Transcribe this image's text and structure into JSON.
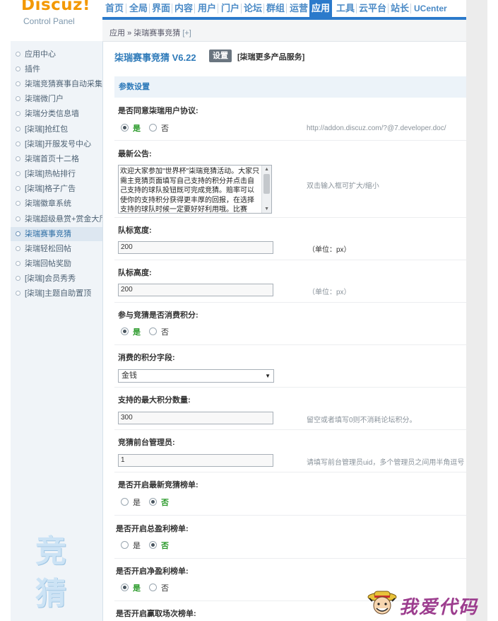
{
  "logo": {
    "main": "Discuz!",
    "sub": "Control Panel"
  },
  "nav": [
    "首页",
    "全局",
    "界面",
    "内容",
    "用户",
    "门户",
    "论坛",
    "群组",
    "运营",
    "应用",
    "工具",
    "云平台",
    "站长",
    "UCenter"
  ],
  "nav_active": "应用",
  "sidebar": {
    "items": [
      "应用中心",
      "插件",
      "柒瑞竞猜赛事自动采集插件",
      "柒瑞微门户",
      "柒瑞分类信息墙",
      "[柒瑞]抢红包",
      "[柒瑞]开服发号中心",
      "柒瑞首页十二格",
      "[柒瑞]热帖排行",
      "[柒瑞]格子广告",
      "柒瑞徽章系统",
      "柒瑞超级悬赏+赏金大厅",
      "柒瑞赛事竞猜",
      "柒瑞轻松回帖",
      "柒瑞回帖奖励",
      "[柒瑞]会员秀秀",
      "[柒瑞]主题自助置顶"
    ],
    "active": "柒瑞赛事竞猜",
    "watermark": "竞猜"
  },
  "breadcrumb": {
    "root": "应用",
    "sep": "»",
    "current": "柒瑞赛事竞猜",
    "add": "[+]"
  },
  "page": {
    "title": "柒瑞赛事竞猜 V6.22",
    "settings_button": "设置",
    "more_link": "[柒瑞更多产品服务]"
  },
  "section_title": "参数设置",
  "fields": {
    "agreement": {
      "label": "是否同意柒瑞用户协议:",
      "yes": "是",
      "no": "否",
      "comment": "http://addon.discuz.com/?@7.developer.doc/"
    },
    "notice": {
      "label": "最新公告:",
      "value": "欢迎大家参加\"世界杯\"柒瑞竞猜活动。大家只需主竞猜页面填写自己支持的积分并点击自己支持的球队投钮既可完成竞猜。赔率可以使你的支持积分获得更丰厚的回报，在选择支持的球队时候一定要好好利用哦。比赛",
      "comment": "双击输入框可扩大/缩小"
    },
    "logo_width": {
      "label": "队标宽度:",
      "value": "200",
      "comment": "（单位：px）"
    },
    "logo_height": {
      "label": "队标高度:",
      "value": "200",
      "comment": "（单位：px）"
    },
    "consume_points": {
      "label": "参与竞猜是否消费积分:",
      "yes": "是",
      "no": "否"
    },
    "points_field": {
      "label": "消费的积分字段:",
      "value": "金钱"
    },
    "max_points": {
      "label": "支持的最大积分数量:",
      "value": "300",
      "comment": "留空或者填写0则不消耗论坛积分。"
    },
    "admins": {
      "label": "竞猜前台管理员:",
      "value": "1",
      "comment": "请填写前台管理员uid，多个管理员之间用半角逗号"
    },
    "latest_rank": {
      "label": "是否开启最新竞猜榜单:",
      "yes": "是",
      "no": "否"
    },
    "total_profit_rank": {
      "label": "是否开启总盈利榜单:",
      "yes": "是",
      "no": "否"
    },
    "net_profit_rank": {
      "label": "是否开启净盈利榜单:",
      "yes": "是",
      "no": "否"
    },
    "win_rank": {
      "label": "是否开启赢取场次榜单:"
    }
  },
  "brand": {
    "text": "我爱代码"
  }
}
